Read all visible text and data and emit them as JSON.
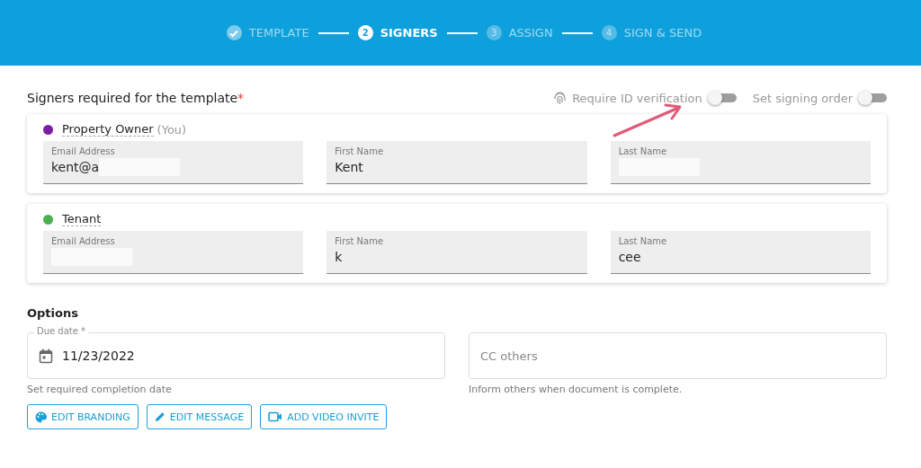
{
  "steps": [
    {
      "label": "TEMPLATE",
      "done": true,
      "selected": false
    },
    {
      "number": "2",
      "label": "SIGNERS",
      "done": false,
      "selected": true
    },
    {
      "number": "3",
      "label": "ASSIGN",
      "done": false,
      "selected": false
    },
    {
      "number": "4",
      "label": "SIGN & SEND",
      "done": false,
      "selected": false
    }
  ],
  "signers_title": "Signers required for the template",
  "required_mark": "*",
  "toggles": [
    {
      "label": "Require ID verification",
      "icon": true,
      "on": false
    },
    {
      "label": "Set signing order",
      "icon": false,
      "on": false
    }
  ],
  "signers": [
    {
      "role": "Property Owner",
      "suffix": "(You)",
      "color": "#7b1fa2",
      "fields": [
        {
          "label": "Email Address",
          "value": "kent@a",
          "redacted": true
        },
        {
          "label": "First Name",
          "value": "Kent",
          "redacted": false
        },
        {
          "label": "Last Name",
          "redacted": true
        }
      ]
    },
    {
      "role": "Tenant",
      "color": "#4caf50",
      "fields": [
        {
          "label": "Email Address",
          "redacted": true
        },
        {
          "label": "First Name",
          "value": "k",
          "redacted": false
        },
        {
          "label": "Last Name",
          "value": "cee",
          "redacted": false
        }
      ]
    }
  ],
  "options_title": "Options",
  "due_date": {
    "label": "Due date *",
    "value": "11/23/2022",
    "hint": "Set required completion date"
  },
  "cc": {
    "placeholder": "CC others",
    "hint": "Inform others when document is complete."
  },
  "buttons": [
    {
      "label": "EDIT BRANDING",
      "kind": "palette"
    },
    {
      "label": "EDIT MESSAGE",
      "kind": "pencil"
    },
    {
      "label": "ADD VIDEO INVITE",
      "kind": "video"
    }
  ]
}
